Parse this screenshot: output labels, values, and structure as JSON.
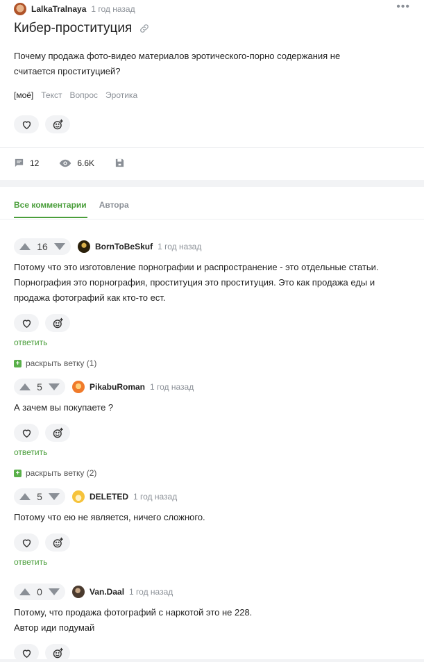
{
  "post": {
    "author": "LalkaTralnaya",
    "time": "1 год назад",
    "title": "Кибер-проституция",
    "body": "Почему продажа фото-видео материалов эротического-порно содержания не считается проституцией?",
    "tags": [
      "[моё]",
      "Текст",
      "Вопрос",
      "Эротика"
    ],
    "comments_count": "12",
    "views": "6.6K"
  },
  "tabs": [
    "Все комментарии",
    "Автора"
  ],
  "actions": {
    "reply": "ответить"
  },
  "comments": [
    {
      "score": "16",
      "author": "BornToBeSkuf",
      "time": "1 год назад",
      "text": "Потому что это изготовление порнографии и распространение - это отдельные статьи. Порнография это порнография, проституция это проституция. Это как продажа еды и продажа фотографий как кто-то ест.",
      "expand": "раскрыть ветку (1)",
      "avatar_color": "#3b2e10"
    },
    {
      "score": "5",
      "author": "PikabuRoman",
      "time": "1 год назад",
      "text": "А зачем вы покупаете ?",
      "expand": "раскрыть ветку (2)",
      "avatar_color": "#f07a2a"
    },
    {
      "score": "5",
      "author": "DELETED",
      "time": "1 год назад",
      "text": "Потому что ею не является, ничего сложного.",
      "avatar_color": "#f6c33b"
    },
    {
      "score": "0",
      "author": "Van.Daal",
      "time": "1 год назад",
      "text_lines": [
        "Потому, что продажа фотографий с наркотой это не 228.",
        "Автор иди подумай"
      ],
      "avatar_color": "#4a3a2e"
    }
  ],
  "colors": {
    "accent": "#4a9e3b",
    "muted": "#8a8f96",
    "background": "#f2f3f5"
  }
}
